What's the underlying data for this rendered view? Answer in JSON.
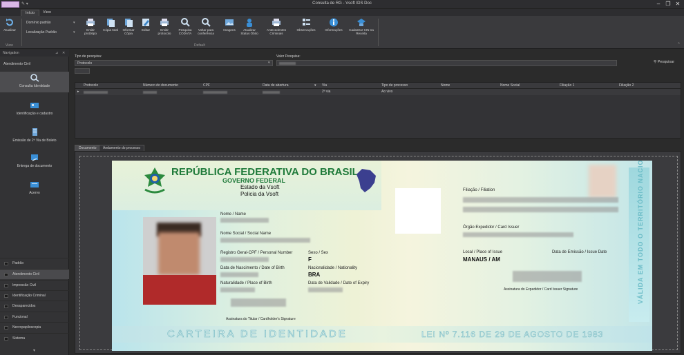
{
  "window": {
    "title": "Consulta de RG - Vsoft IDS Doc"
  },
  "ribbon": {
    "tabs": [
      "Início",
      "View"
    ],
    "actualizar_label": "Atualizar",
    "combo_dominio": "Domínio padrão",
    "combo_localizacao": "Localização Padrão",
    "buttons": [
      {
        "label": "Emitir protótipo"
      },
      {
        "label": "Cópia total"
      },
      {
        "label": "Informar Cópia"
      },
      {
        "label": "Editar"
      },
      {
        "label": "Emitir protocolo"
      },
      {
        "label": "Pesquisa CODATA"
      },
      {
        "label": "Voltar para conferência"
      },
      {
        "label": "Imagens"
      },
      {
        "label": "Atualizar Status Óbito"
      },
      {
        "label": "Antecedentes Criminais"
      },
      {
        "label": "Observações"
      },
      {
        "label": "Informações"
      },
      {
        "label": "Cadastrar CIN na Receita"
      }
    ],
    "group_view": "View",
    "group_default": "Default"
  },
  "nav": {
    "header": "Navigation",
    "group_title": "Atendimento Civil",
    "items": [
      {
        "label": "Consulta Identidade"
      },
      {
        "label": "Identificação e cadastro"
      },
      {
        "label": "Emissão de 2ª Via de Boleto"
      },
      {
        "label": "Entrega de documento"
      },
      {
        "label": "Acervo"
      }
    ],
    "groups": [
      "Padrão",
      "Atendimento Civil",
      "Impressão Civil",
      "Identificação Criminal",
      "Desaparecidos",
      "Funcional",
      "Necropapiloscopia",
      "Sistema"
    ]
  },
  "search": {
    "tipo_label": "Tipo de pesquisa:",
    "tipo_value": "Protocolo",
    "valor_label": "Valor Pesquisa:",
    "pesquisar_label": "Pesquisar"
  },
  "grid": {
    "headers": [
      "Protocolo",
      "Número do documento",
      "CPF",
      "Data de abertura",
      "Via",
      "Tipo de processo",
      "Nome",
      "Nome Social",
      "Filiação 1",
      "Filiação 2"
    ],
    "row_via": "2ª via",
    "row_tipo": "Ao vivo"
  },
  "doctabs": [
    "Documento",
    "Andamento do processo"
  ],
  "card": {
    "republica": "REPÚBLICA FEDERATIVA DO BRASIL",
    "governo": "GOVERNO FEDERAL",
    "estado": "Estado da Vsoft",
    "policia": "Policia da Vsoft",
    "nome_lbl": "Nome / Name",
    "nome_social_lbl": "Nome Social / Social Name",
    "registro_lbl": "Registro Geral-CPF / Personal Number",
    "sexo_lbl": "Sexo / Sex",
    "sexo_val": "F",
    "nascimento_lbl": "Data de Nascimento / Date of Birth",
    "nacionalidade_lbl": "Nacionalidade / Nationality",
    "nacionalidade_val": "BRA",
    "naturalidade_lbl": "Naturalidade / Place of Birth",
    "validade_lbl": "Data de Validade / Date of Expiry",
    "assinatura_lbl": "Assinatura do Titular / Cardholder's Signature",
    "filiacao_lbl": "Filiação / Filiation",
    "orgao_lbl": "Órgão Expedidor / Card Issuer",
    "local_lbl": "Local / Place of Issue",
    "local_val": "MANAUS / AM",
    "emissao_lbl": "Data de Emissão / Issue Date",
    "assinatura_exp_lbl": "Assinatura do Expedidor / Card Issuer Signature",
    "carteira": "CARTEIRA DE IDENTIDADE",
    "lei": "LEI Nº 7.116 DE 29 DE AGOSTO DE 1983",
    "vertical": "VÁLIDA EM TODO O TERRITÓRIO NACIONAL"
  },
  "colors": {
    "accent": "#d9b7e6",
    "icon_blue": "#3a8fd6",
    "card_green": "#1f7a3a"
  }
}
